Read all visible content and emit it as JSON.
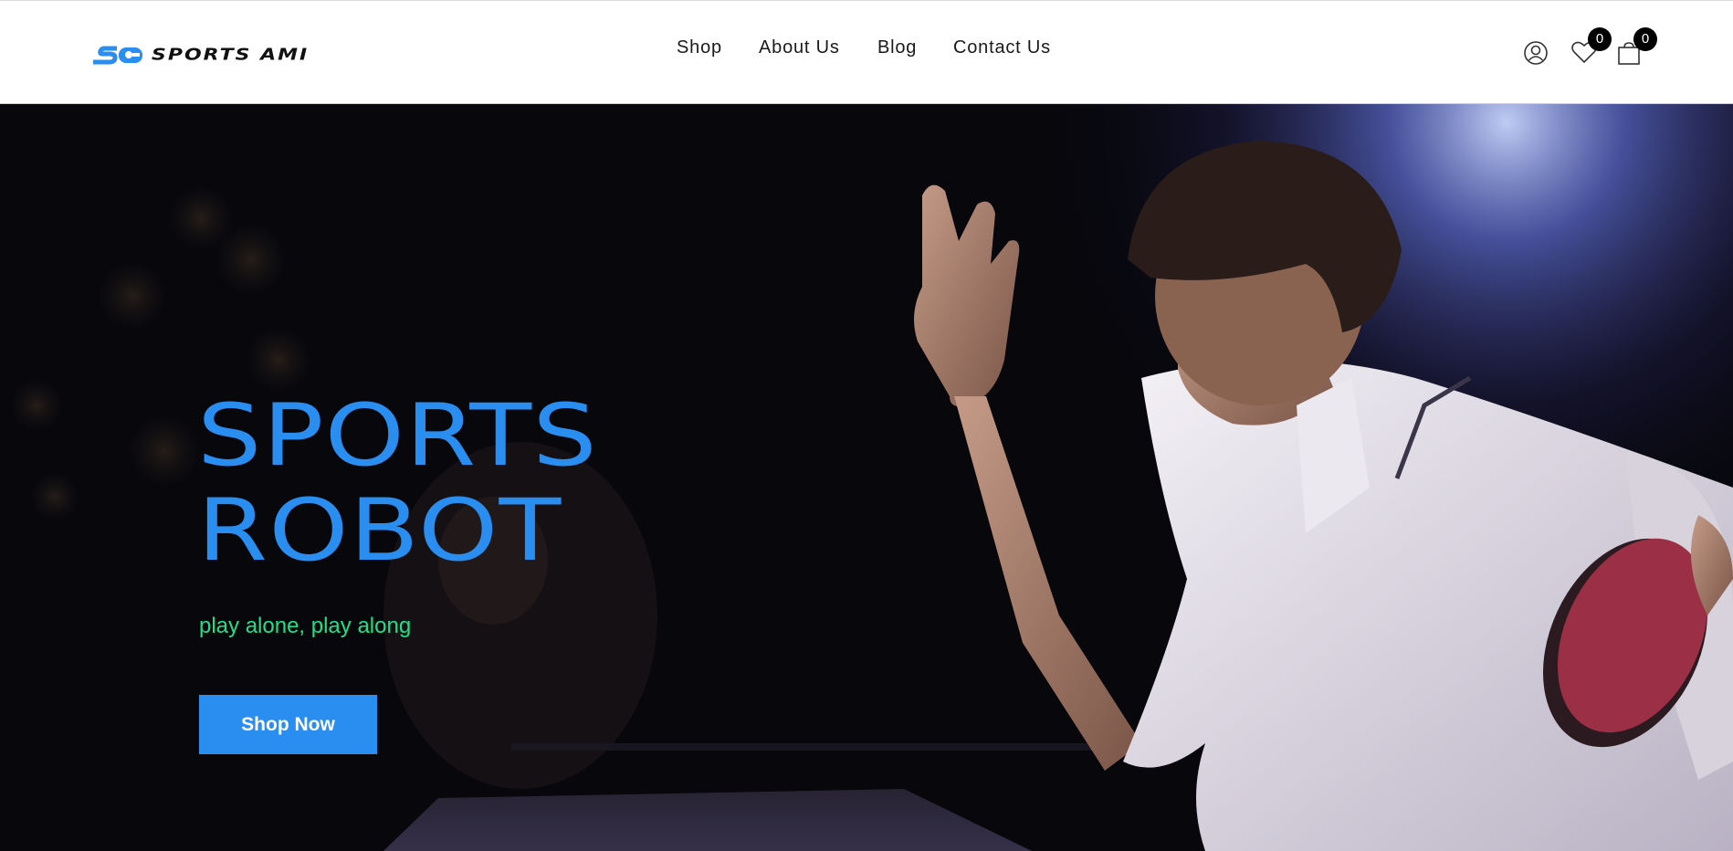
{
  "header": {
    "logo_text": "SPORTS AMI",
    "nav": [
      "Shop",
      "About Us",
      "Blog",
      "Contact Us"
    ],
    "wishlist_count": "0",
    "cart_count": "0"
  },
  "hero": {
    "title_line1": "SPORTS",
    "title_line2": "ROBOT",
    "subtitle": "play alone, play along",
    "cta_label": "Shop Now"
  },
  "colors": {
    "accent_blue": "#2a8df0",
    "subtitle_green": "#1fe08a",
    "hero_background": "#07070c"
  },
  "icons": [
    "user-icon",
    "heart-icon",
    "cart-icon"
  ]
}
